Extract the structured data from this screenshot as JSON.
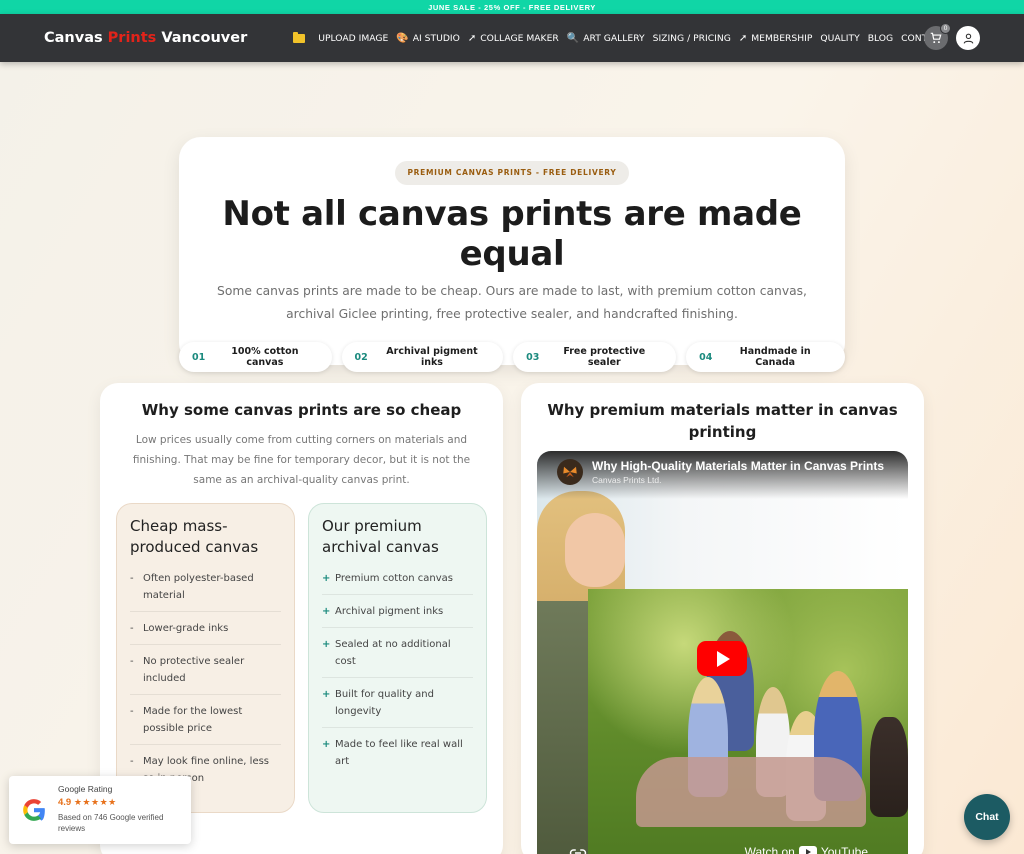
{
  "promo": {
    "text": "JUNE SALE - 25% OFF - FREE DELIVERY"
  },
  "nav": {
    "brand_part1": "Canvas ",
    "brand_part2": "Prints",
    "brand_part3": " Vancouver",
    "items": [
      {
        "label": "UPLOAD IMAGE",
        "icon": "folder-icon"
      },
      {
        "label": "AI STUDIO",
        "icon": "palette-icon"
      },
      {
        "label": "COLLAGE MAKER",
        "icon": "arrow-icon"
      },
      {
        "label": "ART GALLERY",
        "icon": "magnifier-icon"
      },
      {
        "label": "SIZING / PRICING",
        "icon": ""
      },
      {
        "label": "MEMBERSHIP",
        "icon": "arrow-icon"
      },
      {
        "label": "QUALITY",
        "icon": ""
      },
      {
        "label": "BLOG",
        "icon": ""
      },
      {
        "label": "CONTACT",
        "icon": ""
      }
    ],
    "cart_count": "0"
  },
  "hero": {
    "badge": "PREMIUM CANVAS PRINTS - FREE DELIVERY",
    "title": "Not all canvas prints are made equal",
    "subtitle": "Some canvas prints are made to be cheap. Ours are made to last, with premium cotton canvas, archival Giclee printing, free protective sealer, and handcrafted finishing.",
    "chips": [
      {
        "num": "01",
        "label": "100% cotton canvas"
      },
      {
        "num": "02",
        "label": "Archival pigment inks"
      },
      {
        "num": "03",
        "label": "Free protective sealer"
      },
      {
        "num": "04",
        "label": "Handmade in Canada"
      }
    ]
  },
  "left_card": {
    "title": "Why some canvas prints are so cheap",
    "description": "Low prices usually come from cutting corners on materials and finishing. That may be fine for temporary decor, but it is not the same as an archival-quality canvas print.",
    "cheap": {
      "heading": "Cheap mass-produced canvas",
      "marker": "-",
      "items": [
        "Often polyester-based material",
        "Lower-grade inks",
        "No protective sealer included",
        "Made for the lowest possible price",
        "May look fine online, less so in person"
      ]
    },
    "premium": {
      "heading": "Our premium archival canvas",
      "marker": "+",
      "items": [
        "Premium cotton canvas",
        "Archival pigment inks",
        "Sealed at no additional cost",
        "Built for quality and longevity",
        "Made to feel like real wall art"
      ]
    }
  },
  "right_card": {
    "title": "Why premium materials matter in canvas printing",
    "video": {
      "title": "Why High-Quality Materials Matter in Canvas Prints",
      "channel": "Canvas Prints Ltd.",
      "watch_on": "Watch on",
      "youtube": "YouTube"
    }
  },
  "google_badge": {
    "title": "Google Rating",
    "rating": "4.9",
    "stars": "★★★★★",
    "reviews": "Based on 746 Google verified reviews"
  },
  "chat": {
    "label": "Chat"
  },
  "colors": {
    "promo": "#10d6a6",
    "nav_bg": "#333437",
    "brand_red": "#e2231a",
    "accent_teal": "#1b8a7e",
    "chat": "#1c5b63"
  }
}
